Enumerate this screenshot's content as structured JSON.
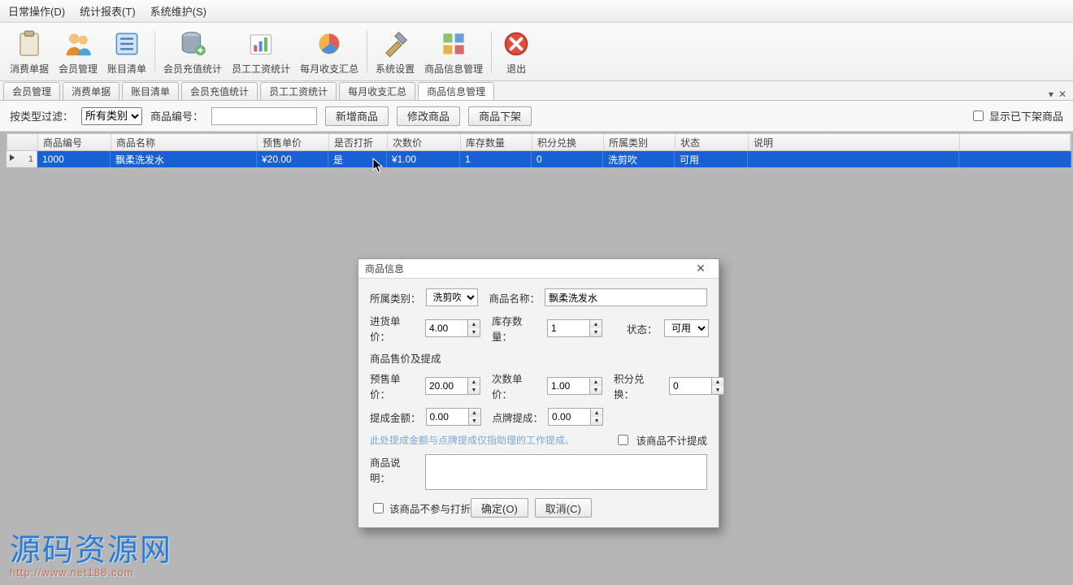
{
  "menu": {
    "daily": "日常操作(D)",
    "report": "统计报表(T)",
    "maint": "系统维护(S)"
  },
  "toolbar": {
    "consume": "消费单据",
    "member": "会员管理",
    "bill": "账目清单",
    "recharge": "会员充值统计",
    "salary": "员工工资统计",
    "monthly": "每月收支汇总",
    "settings": "系统设置",
    "product": "商品信息管理",
    "exit": "退出"
  },
  "tabs": {
    "t0": "会员管理",
    "t1": "消费单据",
    "t2": "账目清单",
    "t3": "会员充值统计",
    "t4": "员工工资统计",
    "t5": "每月收支汇总",
    "t6": "商品信息管理"
  },
  "filter": {
    "byType": "按类型过滤：",
    "allTypes": "所有类别",
    "prodNo": "商品编号：",
    "add": "新增商品",
    "edit": "修改商品",
    "off": "商品下架",
    "showOff": "显示已下架商品"
  },
  "columns": {
    "id": "商品编号",
    "name": "商品名称",
    "price": "预售单价",
    "discount": "是否打折",
    "countPrice": "次数价",
    "stock": "库存数量",
    "points": "积分兑换",
    "category": "所属类别",
    "status": "状态",
    "desc": "说明"
  },
  "row1": {
    "idx": "1",
    "id": "1000",
    "name": "飘柔洗发水",
    "price": "¥20.00",
    "discount": "是",
    "countPrice": "¥1.00",
    "stock": "1",
    "points": "0",
    "category": "洗剪吹",
    "status": "可用",
    "desc": ""
  },
  "dialog": {
    "title": "商品信息",
    "catLabel": "所属类别：",
    "catValue": "洗剪吹",
    "nameLabel": "商品名称：",
    "nameValue": "飘柔洗发水",
    "purchaseLabel": "进货单价：",
    "purchaseValue": "4.00",
    "stockLabel": "库存数量：",
    "stockValue": "1",
    "statusLabel": "状态：",
    "statusValue": "可用",
    "sectionPrice": "商品售价及提成",
    "presaleLabel": "预售单价：",
    "presaleValue": "20.00",
    "countPriceLabel": "次数单价：",
    "countPriceValue": "1.00",
    "pointsLabel": "积分兑换：",
    "pointsValue": "0",
    "commissionLabel": "提成金额：",
    "commissionValue": "0.00",
    "clickLabel": "点牌提成：",
    "clickValue": "0.00",
    "hint": "此处提成金额与点牌提成仅指助理的工作提成。",
    "noCommission": "该商品不计提成",
    "descLabel": "商品说明：",
    "descValue": "",
    "noDiscount": "该商品不参与打折",
    "ok": "确定(O)",
    "cancel": "取消(C)"
  },
  "watermark": {
    "text": "源码资源网",
    "url": "http://www.net188.com"
  }
}
